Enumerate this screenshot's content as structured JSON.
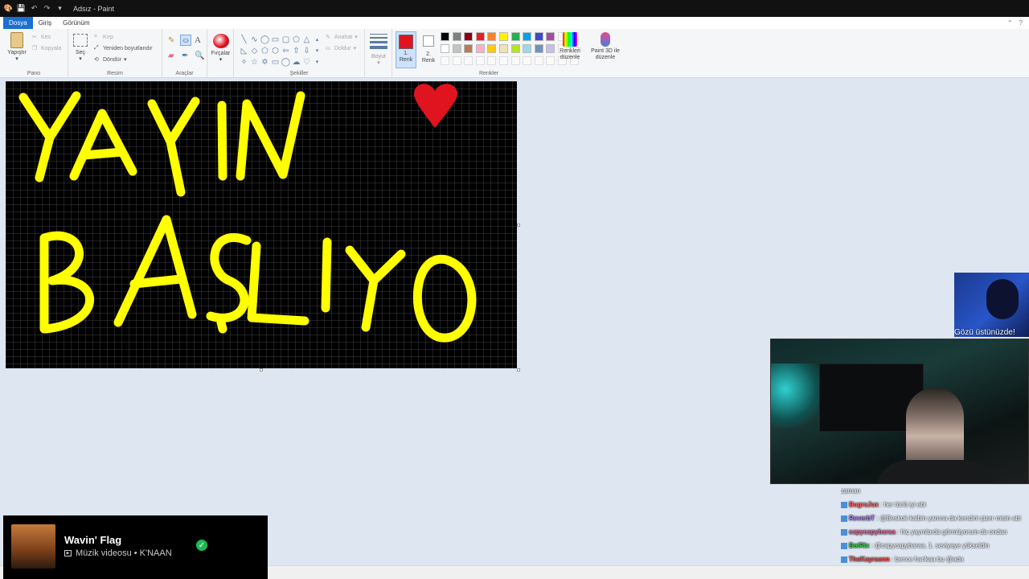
{
  "window": {
    "title": "Adsız - Paint"
  },
  "tabs": [
    {
      "label": "Dosya"
    },
    {
      "label": "Giriş"
    },
    {
      "label": "Görünüm"
    }
  ],
  "ribbon": {
    "pano": {
      "label": "Pano",
      "paste": "Yapıştır",
      "cut": "Kes",
      "copy": "Kopyala"
    },
    "resim": {
      "label": "Resim",
      "select": "Seç",
      "crop": "Kırp",
      "resize": "Yeniden boyutlandır",
      "rotate": "Döndür"
    },
    "araclar": {
      "label": "Araçlar"
    },
    "brushes": {
      "label": "Fırçalar"
    },
    "sekiller": {
      "label": "Şekiller",
      "outline": "Anahat",
      "fill": "Doldur"
    },
    "size": {
      "label": "Boyut"
    },
    "renkler": {
      "label": "Renkler",
      "color1": "1. Renk",
      "color2": "2. Renk",
      "edit_colors": "Renkleri düzenle",
      "paint3d": "Paint 3D ile düzenle",
      "color1_hex": "#e0141e",
      "color2_hex": "#ffffff",
      "palette_row1": [
        "#000000",
        "#7f7f7f",
        "#880015",
        "#ed1c24",
        "#ff7f27",
        "#fff200",
        "#22b14c",
        "#00a2e8",
        "#3f48cc",
        "#a349a4"
      ],
      "palette_row2": [
        "#ffffff",
        "#c3c3c3",
        "#b97a57",
        "#ffaec9",
        "#ffc90e",
        "#efe4b0",
        "#b5e61d",
        "#99d9ea",
        "#7092be",
        "#c8bfe7"
      ]
    }
  },
  "canvas": {
    "background": "#000000",
    "stroke_color": "#ffff00",
    "heart_color": "#e0141e"
  },
  "overlay": {
    "cam_caption": "Gözü üstünüzde!",
    "chat": [
      {
        "user": "",
        "user_color": "#ffffff",
        "text": "zaman"
      },
      {
        "user": "BugraJux",
        "user_color": "#ff6b6b",
        "text": ": her türlü iyi abi"
      },
      {
        "user": "ReverbT",
        "user_color": "#b57cff",
        "text": ": @Beskok kalbin yanına da kendini çizer misin abi"
      },
      {
        "user": "capycapybaraa",
        "user_color": "#ff5fa2",
        "text": ": hiç yayınlarda görmüyorum da ondan"
      },
      {
        "user": "BoiRlx",
        "user_color": "#38d14b",
        "text": ": @capycapybaraa, 1. seviyeye yükseldin"
      },
      {
        "user": "TheKayraenn",
        "user_color": "#ff4f4f",
        "text": ": bence harikaa bu @ada"
      }
    ],
    "music": {
      "song": "Wavin' Flag",
      "subtitle": "Müzik videosu • K'NAAN"
    }
  }
}
